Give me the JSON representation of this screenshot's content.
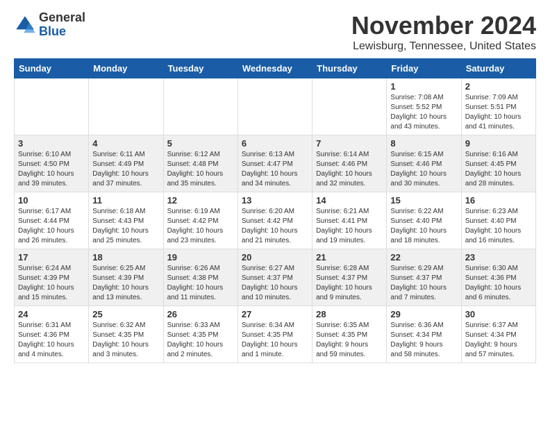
{
  "logo": {
    "line1": "General",
    "line2": "Blue"
  },
  "title": "November 2024",
  "subtitle": "Lewisburg, Tennessee, United States",
  "weekdays": [
    "Sunday",
    "Monday",
    "Tuesday",
    "Wednesday",
    "Thursday",
    "Friday",
    "Saturday"
  ],
  "weeks": [
    [
      {
        "day": "",
        "info": ""
      },
      {
        "day": "",
        "info": ""
      },
      {
        "day": "",
        "info": ""
      },
      {
        "day": "",
        "info": ""
      },
      {
        "day": "",
        "info": ""
      },
      {
        "day": "1",
        "info": "Sunrise: 7:08 AM\nSunset: 5:52 PM\nDaylight: 10 hours\nand 43 minutes."
      },
      {
        "day": "2",
        "info": "Sunrise: 7:09 AM\nSunset: 5:51 PM\nDaylight: 10 hours\nand 41 minutes."
      }
    ],
    [
      {
        "day": "3",
        "info": "Sunrise: 6:10 AM\nSunset: 4:50 PM\nDaylight: 10 hours\nand 39 minutes."
      },
      {
        "day": "4",
        "info": "Sunrise: 6:11 AM\nSunset: 4:49 PM\nDaylight: 10 hours\nand 37 minutes."
      },
      {
        "day": "5",
        "info": "Sunrise: 6:12 AM\nSunset: 4:48 PM\nDaylight: 10 hours\nand 35 minutes."
      },
      {
        "day": "6",
        "info": "Sunrise: 6:13 AM\nSunset: 4:47 PM\nDaylight: 10 hours\nand 34 minutes."
      },
      {
        "day": "7",
        "info": "Sunrise: 6:14 AM\nSunset: 4:46 PM\nDaylight: 10 hours\nand 32 minutes."
      },
      {
        "day": "8",
        "info": "Sunrise: 6:15 AM\nSunset: 4:46 PM\nDaylight: 10 hours\nand 30 minutes."
      },
      {
        "day": "9",
        "info": "Sunrise: 6:16 AM\nSunset: 4:45 PM\nDaylight: 10 hours\nand 28 minutes."
      }
    ],
    [
      {
        "day": "10",
        "info": "Sunrise: 6:17 AM\nSunset: 4:44 PM\nDaylight: 10 hours\nand 26 minutes."
      },
      {
        "day": "11",
        "info": "Sunrise: 6:18 AM\nSunset: 4:43 PM\nDaylight: 10 hours\nand 25 minutes."
      },
      {
        "day": "12",
        "info": "Sunrise: 6:19 AM\nSunset: 4:42 PM\nDaylight: 10 hours\nand 23 minutes."
      },
      {
        "day": "13",
        "info": "Sunrise: 6:20 AM\nSunset: 4:42 PM\nDaylight: 10 hours\nand 21 minutes."
      },
      {
        "day": "14",
        "info": "Sunrise: 6:21 AM\nSunset: 4:41 PM\nDaylight: 10 hours\nand 19 minutes."
      },
      {
        "day": "15",
        "info": "Sunrise: 6:22 AM\nSunset: 4:40 PM\nDaylight: 10 hours\nand 18 minutes."
      },
      {
        "day": "16",
        "info": "Sunrise: 6:23 AM\nSunset: 4:40 PM\nDaylight: 10 hours\nand 16 minutes."
      }
    ],
    [
      {
        "day": "17",
        "info": "Sunrise: 6:24 AM\nSunset: 4:39 PM\nDaylight: 10 hours\nand 15 minutes."
      },
      {
        "day": "18",
        "info": "Sunrise: 6:25 AM\nSunset: 4:39 PM\nDaylight: 10 hours\nand 13 minutes."
      },
      {
        "day": "19",
        "info": "Sunrise: 6:26 AM\nSunset: 4:38 PM\nDaylight: 10 hours\nand 11 minutes."
      },
      {
        "day": "20",
        "info": "Sunrise: 6:27 AM\nSunset: 4:37 PM\nDaylight: 10 hours\nand 10 minutes."
      },
      {
        "day": "21",
        "info": "Sunrise: 6:28 AM\nSunset: 4:37 PM\nDaylight: 10 hours\nand 9 minutes."
      },
      {
        "day": "22",
        "info": "Sunrise: 6:29 AM\nSunset: 4:37 PM\nDaylight: 10 hours\nand 7 minutes."
      },
      {
        "day": "23",
        "info": "Sunrise: 6:30 AM\nSunset: 4:36 PM\nDaylight: 10 hours\nand 6 minutes."
      }
    ],
    [
      {
        "day": "24",
        "info": "Sunrise: 6:31 AM\nSunset: 4:36 PM\nDaylight: 10 hours\nand 4 minutes."
      },
      {
        "day": "25",
        "info": "Sunrise: 6:32 AM\nSunset: 4:35 PM\nDaylight: 10 hours\nand 3 minutes."
      },
      {
        "day": "26",
        "info": "Sunrise: 6:33 AM\nSunset: 4:35 PM\nDaylight: 10 hours\nand 2 minutes."
      },
      {
        "day": "27",
        "info": "Sunrise: 6:34 AM\nSunset: 4:35 PM\nDaylight: 10 hours\nand 1 minute."
      },
      {
        "day": "28",
        "info": "Sunrise: 6:35 AM\nSunset: 4:35 PM\nDaylight: 9 hours\nand 59 minutes."
      },
      {
        "day": "29",
        "info": "Sunrise: 6:36 AM\nSunset: 4:34 PM\nDaylight: 9 hours\nand 58 minutes."
      },
      {
        "day": "30",
        "info": "Sunrise: 6:37 AM\nSunset: 4:34 PM\nDaylight: 9 hours\nand 57 minutes."
      }
    ]
  ]
}
